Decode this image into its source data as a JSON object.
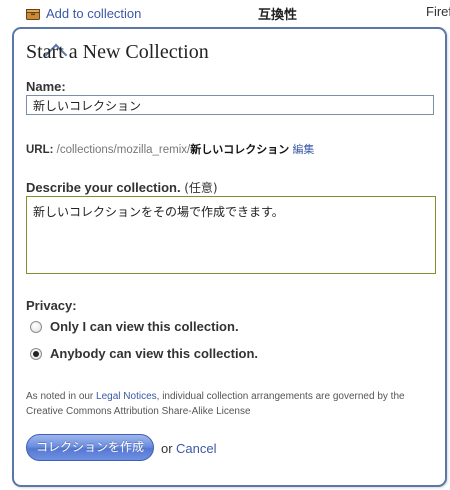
{
  "topbar": {
    "add_link_label": "Add to collection",
    "column_compat": "互換性",
    "column_fire": "Firefox"
  },
  "dialog": {
    "title": "Start a New Collection",
    "name_label": "Name:",
    "name_value": "新しいコレクション",
    "url_label": "URL:",
    "url_path": " /collections/mozilla_remix/",
    "url_slug": "新しいコレクション",
    "url_edit": "編集",
    "description_label": "Describe your collection.",
    "description_optional": "(任意)",
    "description_value": "新しいコレクションをその場で作成できます。",
    "privacy_label": "Privacy:",
    "privacy_options": [
      {
        "label": "Only I can view this collection.",
        "selected": false
      },
      {
        "label": "Anybody can view this collection.",
        "selected": true
      }
    ],
    "legal_prefix": "As noted in our ",
    "legal_link": "Legal Notices",
    "legal_suffix": ", individual collection arrangements are governed by the Creative Commons Attribution Share-Alike License",
    "create_button": "コレクションを作成",
    "or_text": "or",
    "cancel_label": "Cancel"
  },
  "colors": {
    "link": "#3a5aa5",
    "panel_border": "#5b77a6",
    "button": "#6d8fe0"
  },
  "icons": {
    "collection": "box-icon"
  }
}
